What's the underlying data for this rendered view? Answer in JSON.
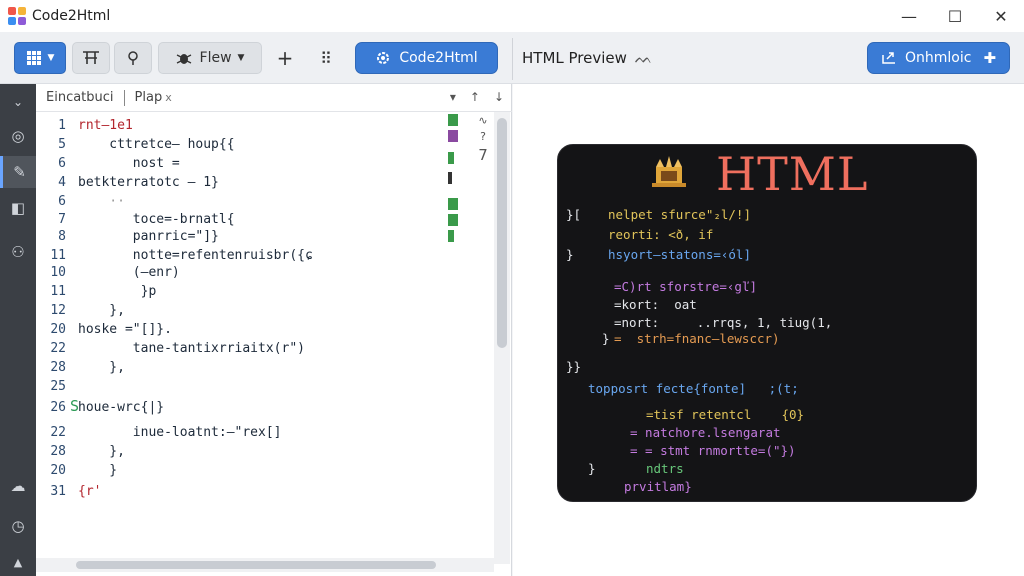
{
  "window": {
    "title": "Code2Html",
    "controls": {
      "minimize": "—",
      "maximize": "☐",
      "close": "✕"
    },
    "logo_colors": [
      "#f0574a",
      "#f5b43a",
      "#3b8ef0",
      "#8e5bd8"
    ]
  },
  "toolbar": {
    "grid_menu_icon": "grid-icon",
    "text_tool_icon": "text-tool-icon",
    "search_icon": "search-icon",
    "flow_label": "Flew",
    "add_label": "+",
    "more_label": "⠿",
    "code2html_label": "Code2Html",
    "preview_label": "HTML Preview",
    "preview_wave": "ᨓ",
    "optimize_label": "Onhmloic"
  },
  "sidebar": {
    "items": [
      {
        "icon": "collapse-icon",
        "glyph": "⌄"
      },
      {
        "icon": "compass-icon",
        "glyph": "◎"
      },
      {
        "icon": "pencil-icon",
        "glyph": "✎"
      },
      {
        "icon": "layout-icon",
        "glyph": "◧"
      },
      {
        "icon": "network-icon",
        "glyph": "⚇"
      },
      {
        "icon": "cloud-icon",
        "glyph": "☁"
      },
      {
        "icon": "clock-icon",
        "glyph": "◷"
      },
      {
        "icon": "warning-icon",
        "glyph": "▲"
      }
    ]
  },
  "editor": {
    "tabs": [
      {
        "label": "Eincatbuci"
      },
      {
        "label": "Plap"
      }
    ],
    "tab_close": "x",
    "tools": [
      "▾",
      "↑",
      "↓"
    ],
    "minimap_numbers": [
      "∿",
      "?",
      "7"
    ],
    "lines": [
      {
        "n": "1",
        "text": "rnt–1e1"
      },
      {
        "n": "5",
        "text": "    cttretce– houp{{"
      },
      {
        "n": "6",
        "text": "       nost ="
      },
      {
        "n": "4",
        "text": "betkterratotc – 1}"
      },
      {
        "n": "6",
        "text": "    ··"
      },
      {
        "n": "7",
        "text": "       toce=-brnatl{"
      },
      {
        "n": "8",
        "text": "       panrric=\"]}"
      },
      {
        "n": "11",
        "text": "       notte=refentenruisbr({ɕ"
      },
      {
        "n": "10",
        "text": "       (–enr)"
      },
      {
        "n": "11",
        "text": "        }p"
      },
      {
        "n": "12",
        "text": "    },"
      },
      {
        "n": "20",
        "text": "hoske =\"[]}."
      },
      {
        "n": "22",
        "text": "       tane-tantixrriaitx(r\")"
      },
      {
        "n": "28",
        "text": "    },"
      },
      {
        "n": "25",
        "text": ""
      },
      {
        "n": "26",
        "text": "houe-wrc{|}"
      },
      {
        "n": "22",
        "text": "       inue-loatnt:–\"rex[]"
      },
      {
        "n": "28",
        "text": "    },"
      },
      {
        "n": "20",
        "text": "    }"
      },
      {
        "n": "31",
        "text": "{r'"
      }
    ],
    "line_marker": "S"
  },
  "preview": {
    "title": "HTML",
    "lines": [
      {
        "t": "nelpet sfurce\"₂l/!]"
      },
      {
        "t": "reorti: <ð, if"
      },
      {
        "t": "hsyort—statons=‹ól]"
      },
      {
        "t": "=C)rt sforstre=‹gľ]"
      },
      {
        "t": "=kort:  oat"
      },
      {
        "t": "=nort:     ..rrqs, 1, tiug(1,"
      },
      {
        "t": "=  strh=fnanc—lewsccr)"
      },
      {
        "t": "topposrt fecte{fonte]   ;(t;"
      },
      {
        "t": "=tisf retentcl    {0}"
      },
      {
        "t": "= natchore.lsengarat"
      },
      {
        "t": "= = stmt rnmortte=(\"})"
      },
      {
        "t": "ndtrs"
      },
      {
        "t": "prvitlam}"
      }
    ],
    "brackets": [
      "}[",
      "},",
      "}",
      "}}",
      "}",
      "]",
      "]",
      "}"
    ]
  },
  "colors": {
    "accent": "#3a7bd5",
    "preview_title": "#ef6f5e"
  }
}
